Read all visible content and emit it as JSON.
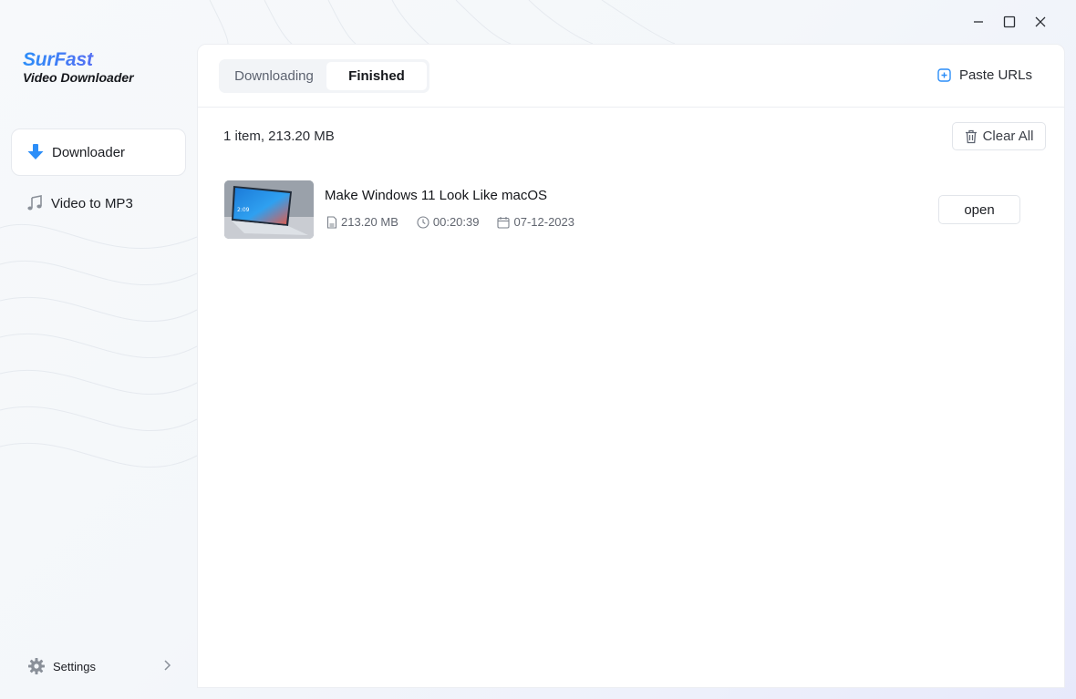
{
  "brand": {
    "name": "SurFast",
    "subtitle": "Video Downloader"
  },
  "window_controls": {
    "minimize": "minimize-icon",
    "maximize": "maximize-icon",
    "close": "close-icon"
  },
  "sidebar": {
    "items": [
      {
        "label": "Downloader",
        "icon": "download-arrow-icon",
        "active": true
      },
      {
        "label": "Video to MP3",
        "icon": "music-note-icon",
        "active": false
      }
    ],
    "settings_label": "Settings"
  },
  "tabs": [
    {
      "label": "Downloading",
      "active": false
    },
    {
      "label": "Finished",
      "active": true
    }
  ],
  "paste_urls_label": "Paste URLs",
  "summary": "1 item, 213.20 MB",
  "clear_all_label": "Clear All",
  "items": [
    {
      "title": "Make Windows 11 Look Like macOS",
      "size": "213.20 MB",
      "duration": "00:20:39",
      "date": "07-12-2023",
      "action_label": "open"
    }
  ],
  "colors": {
    "accent": "#2c8ef8",
    "brand_gradient_end": "#6a5cf0"
  }
}
